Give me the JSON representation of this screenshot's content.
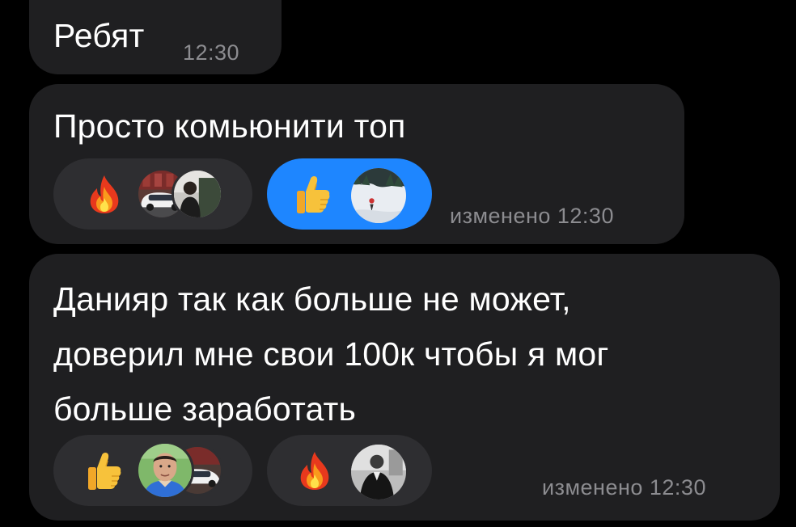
{
  "messages": [
    {
      "text_lines": [
        "Ребят"
      ],
      "time": "12:30"
    },
    {
      "text_lines": [
        "Просто комьюнити топ"
      ],
      "time_label": "изменено 12:30",
      "reactions": [
        {
          "emoji": "fire-icon",
          "active": false
        },
        {
          "emoji": "thumbs-up-icon",
          "active": true
        }
      ]
    },
    {
      "text_lines": [
        "Данияр так как больше не может,",
        "доверил мне свои 100к чтобы я мог",
        "больше заработать"
      ],
      "time_label": "изменено 12:30",
      "reactions": [
        {
          "emoji": "thumbs-up-icon",
          "active": false
        },
        {
          "emoji": "fire-icon",
          "active": false
        }
      ]
    }
  ],
  "colors": {
    "background": "#000000",
    "bubble": "#1f1f21",
    "reaction_inactive": "#2e2e31",
    "reaction_active": "#1e86ff",
    "time_text": "#8c8c90"
  }
}
